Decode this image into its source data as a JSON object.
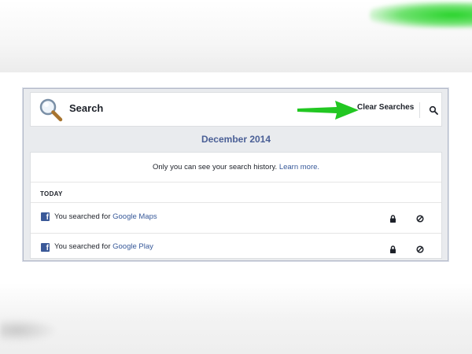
{
  "header": {
    "title": "Search",
    "clear_searches_label": "Clear Searches"
  },
  "month": "December 2014",
  "privacy_notice": {
    "text": "Only you can see your search history.",
    "link": "Learn more."
  },
  "section": "TODAY",
  "entries": [
    {
      "prefix": "You searched for",
      "query": "Google Maps"
    },
    {
      "prefix": "You searched for",
      "query": "Google Play"
    }
  ],
  "colors": {
    "accent_link": "#365899",
    "month_text": "#4a5f96",
    "facebook_blue": "#3b5998",
    "arrow_green": "#22c722"
  },
  "icons": [
    "magnifier-icon",
    "green-arrow-icon",
    "search-icon",
    "facebook-icon",
    "lock-icon",
    "hide-icon"
  ]
}
